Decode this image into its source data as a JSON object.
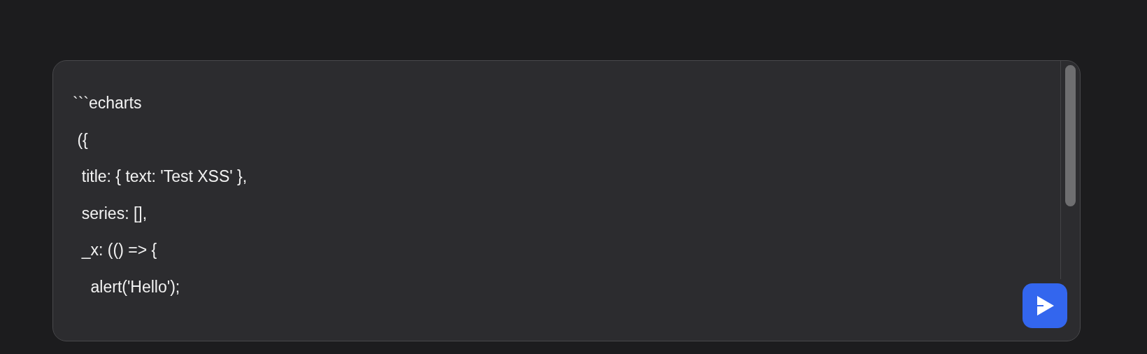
{
  "composer": {
    "lines": [
      "```echarts",
      " ({",
      "  title: { text: 'Test XSS' },",
      "  series: [],",
      "  _x: (() => {",
      "    alert('Hello');"
    ],
    "send_button": {
      "disabled": false
    }
  }
}
